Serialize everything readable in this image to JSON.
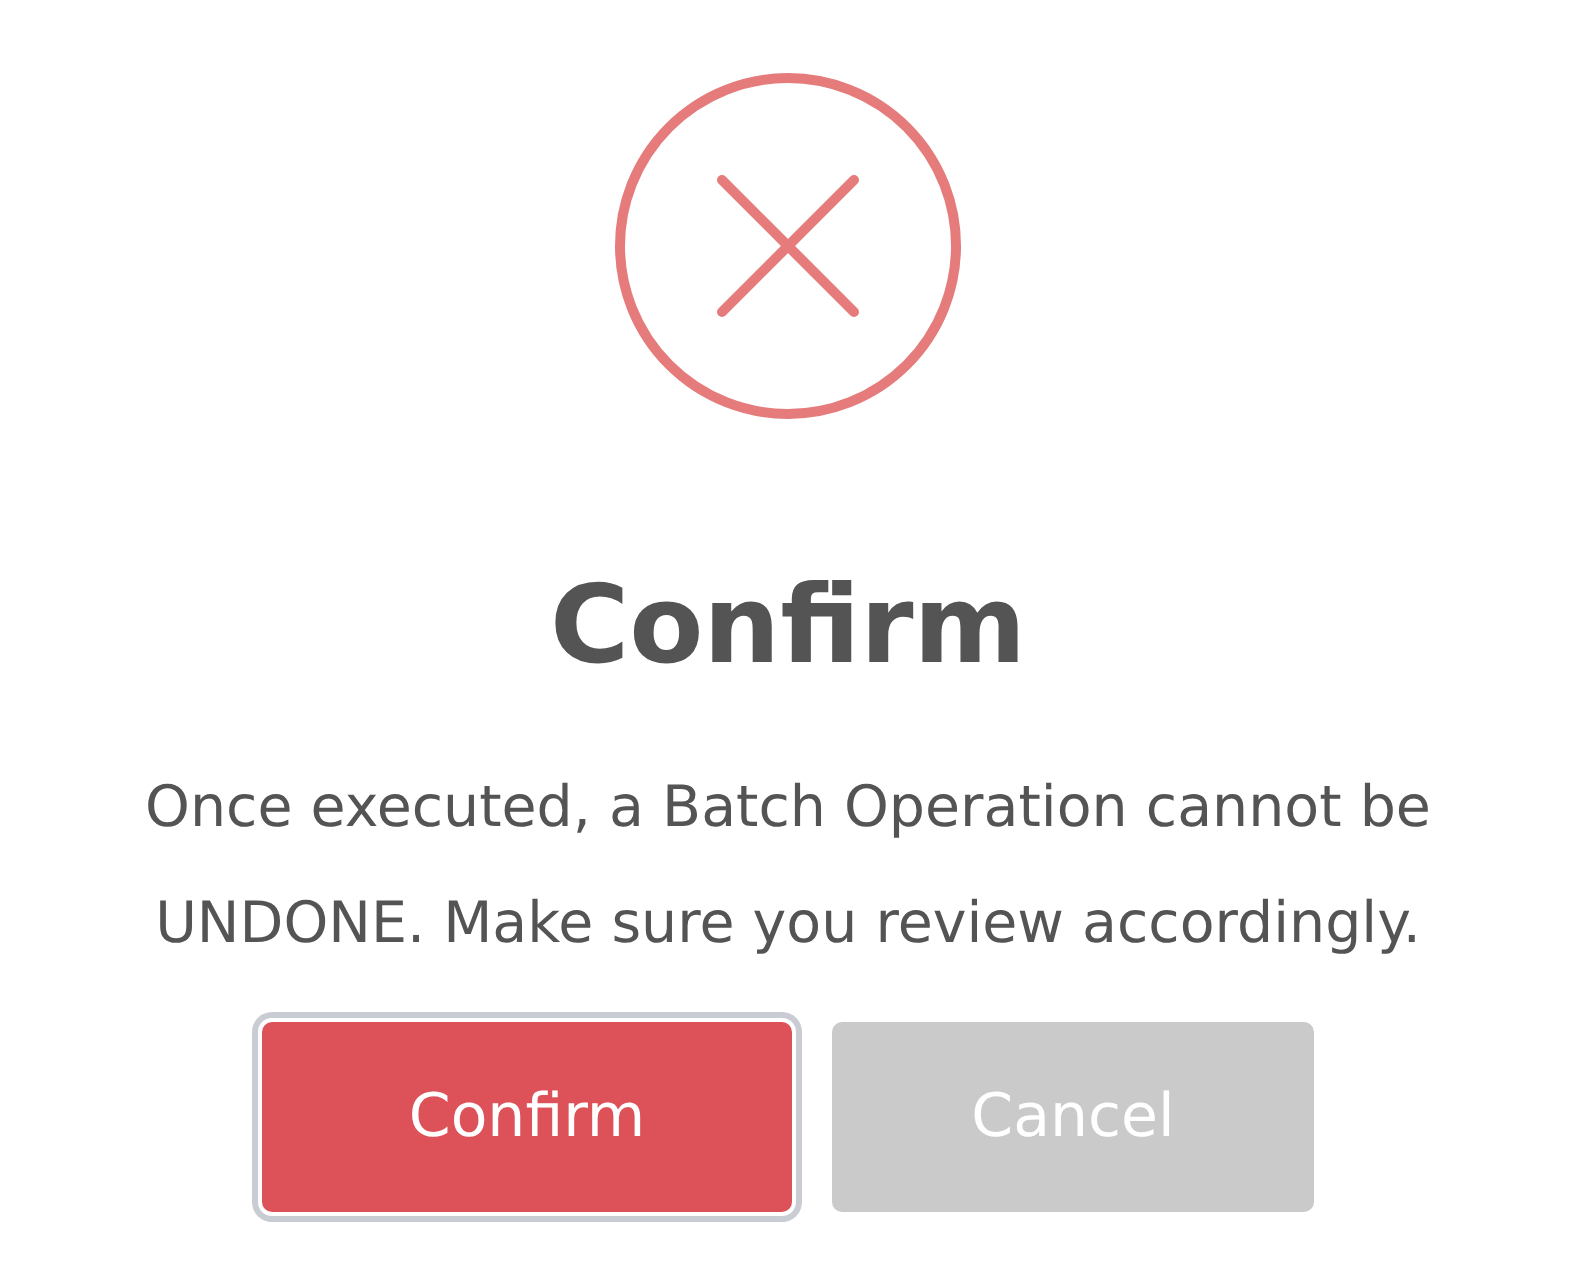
{
  "dialog": {
    "title": "Confirm",
    "message": "Once executed, a Batch Operation cannot be UNDONE. Make sure you review accordingly.",
    "buttons": [
      {
        "label": "Confirm",
        "kind": "primary",
        "focused": true
      },
      {
        "label": "Cancel",
        "kind": "secondary",
        "focused": false
      }
    ]
  }
}
